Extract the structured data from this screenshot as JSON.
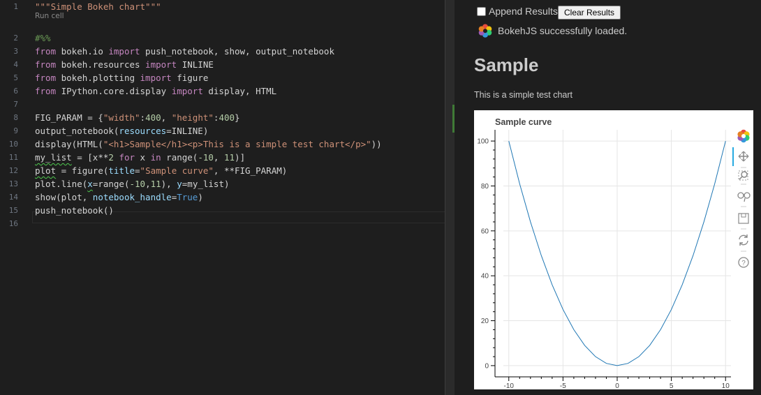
{
  "editor": {
    "codelens": "Run cell",
    "lines": [
      {
        "n": "1",
        "html": "<span class=\"str\">\"\"\"Simple Bokeh chart\"\"\"</span>"
      },
      {
        "n": "2",
        "html": "<span class=\"cm\">#%%</span>"
      },
      {
        "n": "3",
        "html": "<span class=\"kw\">from</span> bokeh.io <span class=\"kw\">import</span> push_notebook, show, output_notebook"
      },
      {
        "n": "4",
        "html": "<span class=\"kw\">from</span> bokeh.resources <span class=\"kw\">import</span> INLINE"
      },
      {
        "n": "5",
        "html": "<span class=\"kw\">from</span> bokeh.plotting <span class=\"kw\">import</span> figure"
      },
      {
        "n": "6",
        "html": "<span class=\"kw\">from</span> IPython.core.display <span class=\"kw\">import</span> display, HTML"
      },
      {
        "n": "7",
        "html": ""
      },
      {
        "n": "8",
        "html": "FIG_PARAM = {<span class=\"str\">\"width\"</span>:<span class=\"num\">400</span>, <span class=\"str\">\"height\"</span>:<span class=\"num\">400</span>}"
      },
      {
        "n": "9",
        "html": "output_notebook(<span class=\"prm\">resources</span>=INLINE)"
      },
      {
        "n": "10",
        "html": "display(HTML(<span class=\"str\">\"&lt;h1&gt;Sample&lt;/h1&gt;&lt;p&gt;This is a simple test chart&lt;/p&gt;\"</span>))"
      },
      {
        "n": "11",
        "html": "<span class=\"sq\">my_list</span> = [x**<span class=\"num\">2</span> <span class=\"kw\">for</span> x <span class=\"kw\">in</span> range(<span class=\"num\">-10</span>, <span class=\"num\">11</span>)]"
      },
      {
        "n": "12",
        "html": "<span class=\"sq\">plot</span> = figure(<span class=\"prm\">title</span>=<span class=\"str\">\"Sample curve\"</span>, **FIG_PARAM)"
      },
      {
        "n": "13",
        "html": "plot.line(<span class=\"prm sq\">x</span>=range(<span class=\"num\">-10</span>,<span class=\"num\">11</span>), <span class=\"prm\">y</span>=my_list)"
      },
      {
        "n": "14",
        "html": "show(plot, <span class=\"prm\">notebook_handle</span>=<span class=\"cst\">True</span>)"
      },
      {
        "n": "15",
        "html": "push_notebook()"
      },
      {
        "n": "16",
        "html": ""
      }
    ]
  },
  "output": {
    "append_label": "Append Results",
    "clear_label": "Clear Results",
    "loaded_text": "BokehJS successfully loaded.",
    "heading": "Sample",
    "paragraph": "This is a simple test chart"
  },
  "chart_data": {
    "type": "line",
    "title": "Sample curve",
    "x": [
      -10,
      -9,
      -8,
      -7,
      -6,
      -5,
      -4,
      -3,
      -2,
      -1,
      0,
      1,
      2,
      3,
      4,
      5,
      6,
      7,
      8,
      9,
      10
    ],
    "series": [
      {
        "values": [
          100,
          81,
          64,
          49,
          36,
          25,
          16,
          9,
          4,
          1,
          0,
          1,
          4,
          9,
          16,
          25,
          36,
          49,
          64,
          81,
          100
        ]
      }
    ],
    "xticks": [
      -10,
      -5,
      0,
      5,
      10
    ],
    "yticks": [
      0,
      20,
      40,
      60,
      80,
      100
    ],
    "xlim": [
      -10.5,
      10.5
    ],
    "ylim": [
      -5,
      105
    ],
    "grid": true,
    "line_color": "#1f77b4",
    "xlabel": "",
    "ylabel": ""
  }
}
